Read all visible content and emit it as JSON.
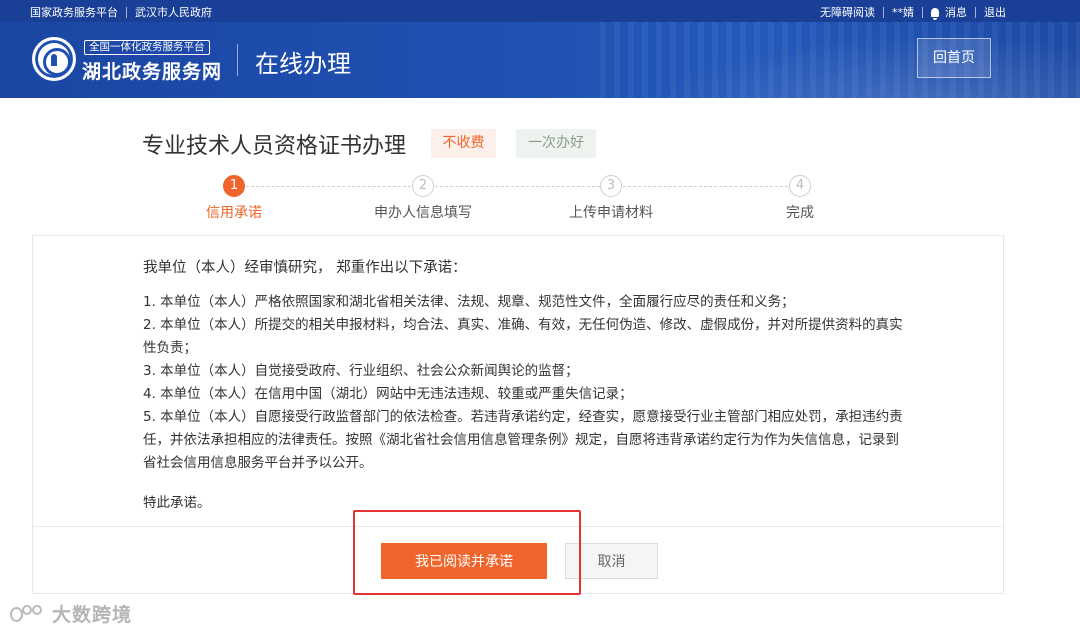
{
  "topbar": {
    "left_links": [
      "国家政务服务平台",
      "武汉市人民政府"
    ],
    "accessibility": "无障碍阅读",
    "user": "**婧",
    "messages": "消息",
    "logout": "退出"
  },
  "header": {
    "logo_subtitle": "全国一体化政务服务平台",
    "logo_title": "湖北政务服务网",
    "page_title": "在线办理",
    "home_button": "回首页"
  },
  "service": {
    "title": "专业技术人员资格证书办理",
    "tag_fee": "不收费",
    "tag_once": "一次办好"
  },
  "steps": [
    {
      "number": "1",
      "label": "信用承诺",
      "active": true
    },
    {
      "number": "2",
      "label": "申办人信息填写",
      "active": false
    },
    {
      "number": "3",
      "label": "上传申请材料",
      "active": false
    },
    {
      "number": "4",
      "label": "完成",
      "active": false
    }
  ],
  "commitment": {
    "lead": "我单位（本人）经审慎研究， 郑重作出以下承诺：",
    "items": [
      "1. 本单位（本人）严格依照国家和湖北省相关法律、法规、规章、规范性文件，全面履行应尽的责任和义务；",
      "2. 本单位（本人）所提交的相关申报材料，均合法、真实、准确、有效，无任何伪造、修改、虚假成份，并对所提供资料的真实性负责；",
      "3. 本单位（本人）自觉接受政府、行业组织、社会公众新闻舆论的监督；",
      "4. 本单位（本人）在信用中国（湖北）网站中无违法违规、较重或严重失信记录；",
      "5. 本单位（本人）自愿接受行政监督部门的依法检查。若违背承诺约定，经查实，愿意接受行业主管部门相应处罚，承担违约责任，并依法承担相应的法律责任。按照《湖北省社会信用信息管理条例》规定，自愿将违背承诺约定行为作为失信信息，记录到省社会信用信息服务平台并予以公开。"
    ],
    "closing": "特此承诺。"
  },
  "actions": {
    "agree": "我已阅读并承诺",
    "cancel": "取消"
  },
  "watermark": "大数跨境",
  "colors": {
    "accent": "#f0652b",
    "header_blue": "#1f4fb0",
    "highlight_red": "#e23232"
  }
}
